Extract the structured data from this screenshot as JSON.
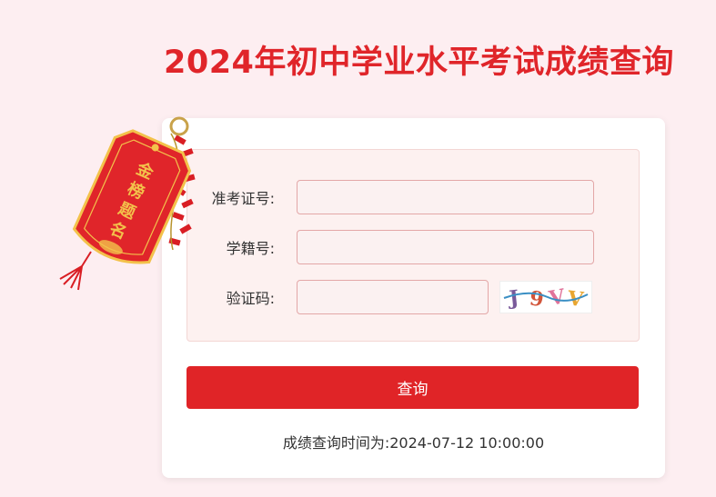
{
  "header": {
    "title": "2024年初中学业水平考试成绩查询"
  },
  "decoration": {
    "charm_text": "金榜题名",
    "colors": {
      "charm_red": "#e0252a",
      "charm_gold": "#f3c24b"
    }
  },
  "form": {
    "exam_number_label": "准考证号:",
    "exam_number_value": "",
    "student_id_label": "学籍号:",
    "student_id_value": "",
    "captcha_label": "验证码:",
    "captcha_value": "",
    "captcha_text": "J9VV"
  },
  "submit_label": "查询",
  "time_note": "成绩查询时间为:2024-07-12 10:00:00",
  "colors": {
    "page_bg": "#fdeef1",
    "accent": "#e02427",
    "panel_bg": "#fdf1f0",
    "input_border": "#e3a7a7"
  }
}
